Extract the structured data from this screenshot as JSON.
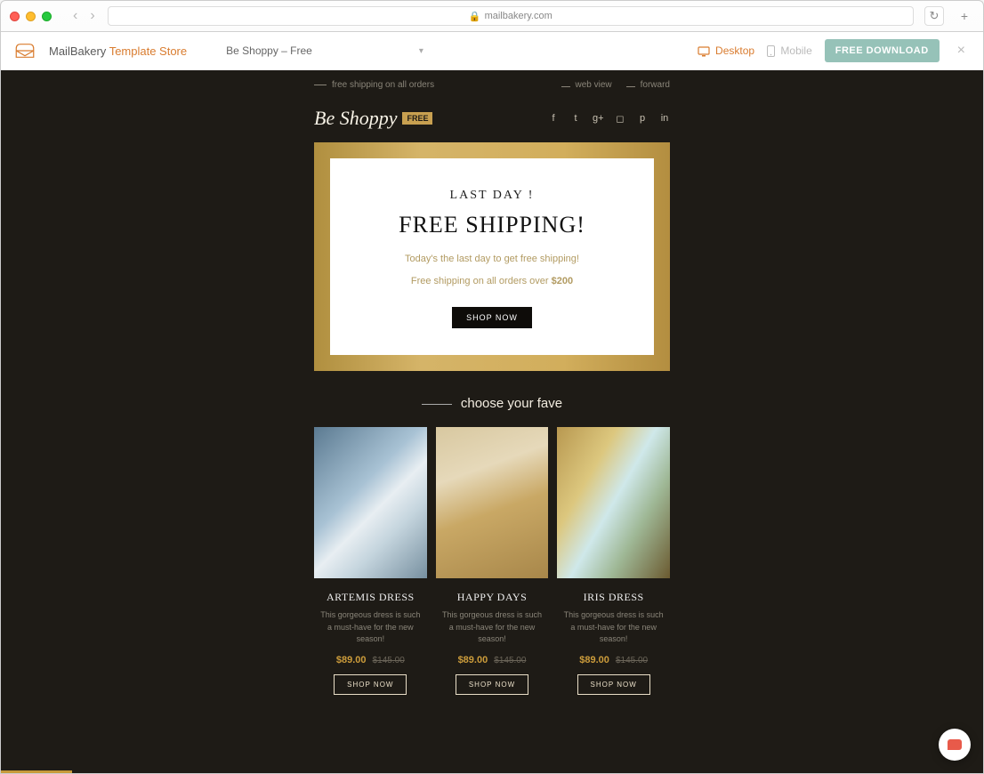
{
  "browser": {
    "url_display": "mailbakery.com"
  },
  "sitebar": {
    "brand_main": "MailBakery",
    "brand_sub": "Template Store",
    "template_name": "Be Shoppy – Free",
    "device_desktop": "Desktop",
    "device_mobile": "Mobile",
    "download_label": "FREE DOWNLOAD"
  },
  "util": {
    "shipping": "free shipping on all orders",
    "webview": "web view",
    "forward": "forward"
  },
  "header": {
    "logo_text": "Be Shoppy",
    "badge": "FREE"
  },
  "hero": {
    "eyebrow": "LAST DAY !",
    "title": "FREE SHIPPING!",
    "sub1": "Today's the last day to get free shipping!",
    "sub2_prefix": "Free shipping on all orders over ",
    "sub2_amount": "$200",
    "cta": "SHOP NOW"
  },
  "section_heading": "choose your fave",
  "products": [
    {
      "title": "ARTEMIS DRESS",
      "desc": "This gorgeous dress is such a must-have for the new season!",
      "price": "$89.00",
      "old": "$145.00",
      "cta": "SHOP NOW"
    },
    {
      "title": "HAPPY DAYS",
      "desc": "This gorgeous dress is such a must-have for the new season!",
      "price": "$89.00",
      "old": "$145.00",
      "cta": "SHOP NOW"
    },
    {
      "title": "IRIS DRESS",
      "desc": "This gorgeous dress is such a must-have for the new season!",
      "price": "$89.00",
      "old": "$145.00",
      "cta": "SHOP NOW"
    }
  ]
}
